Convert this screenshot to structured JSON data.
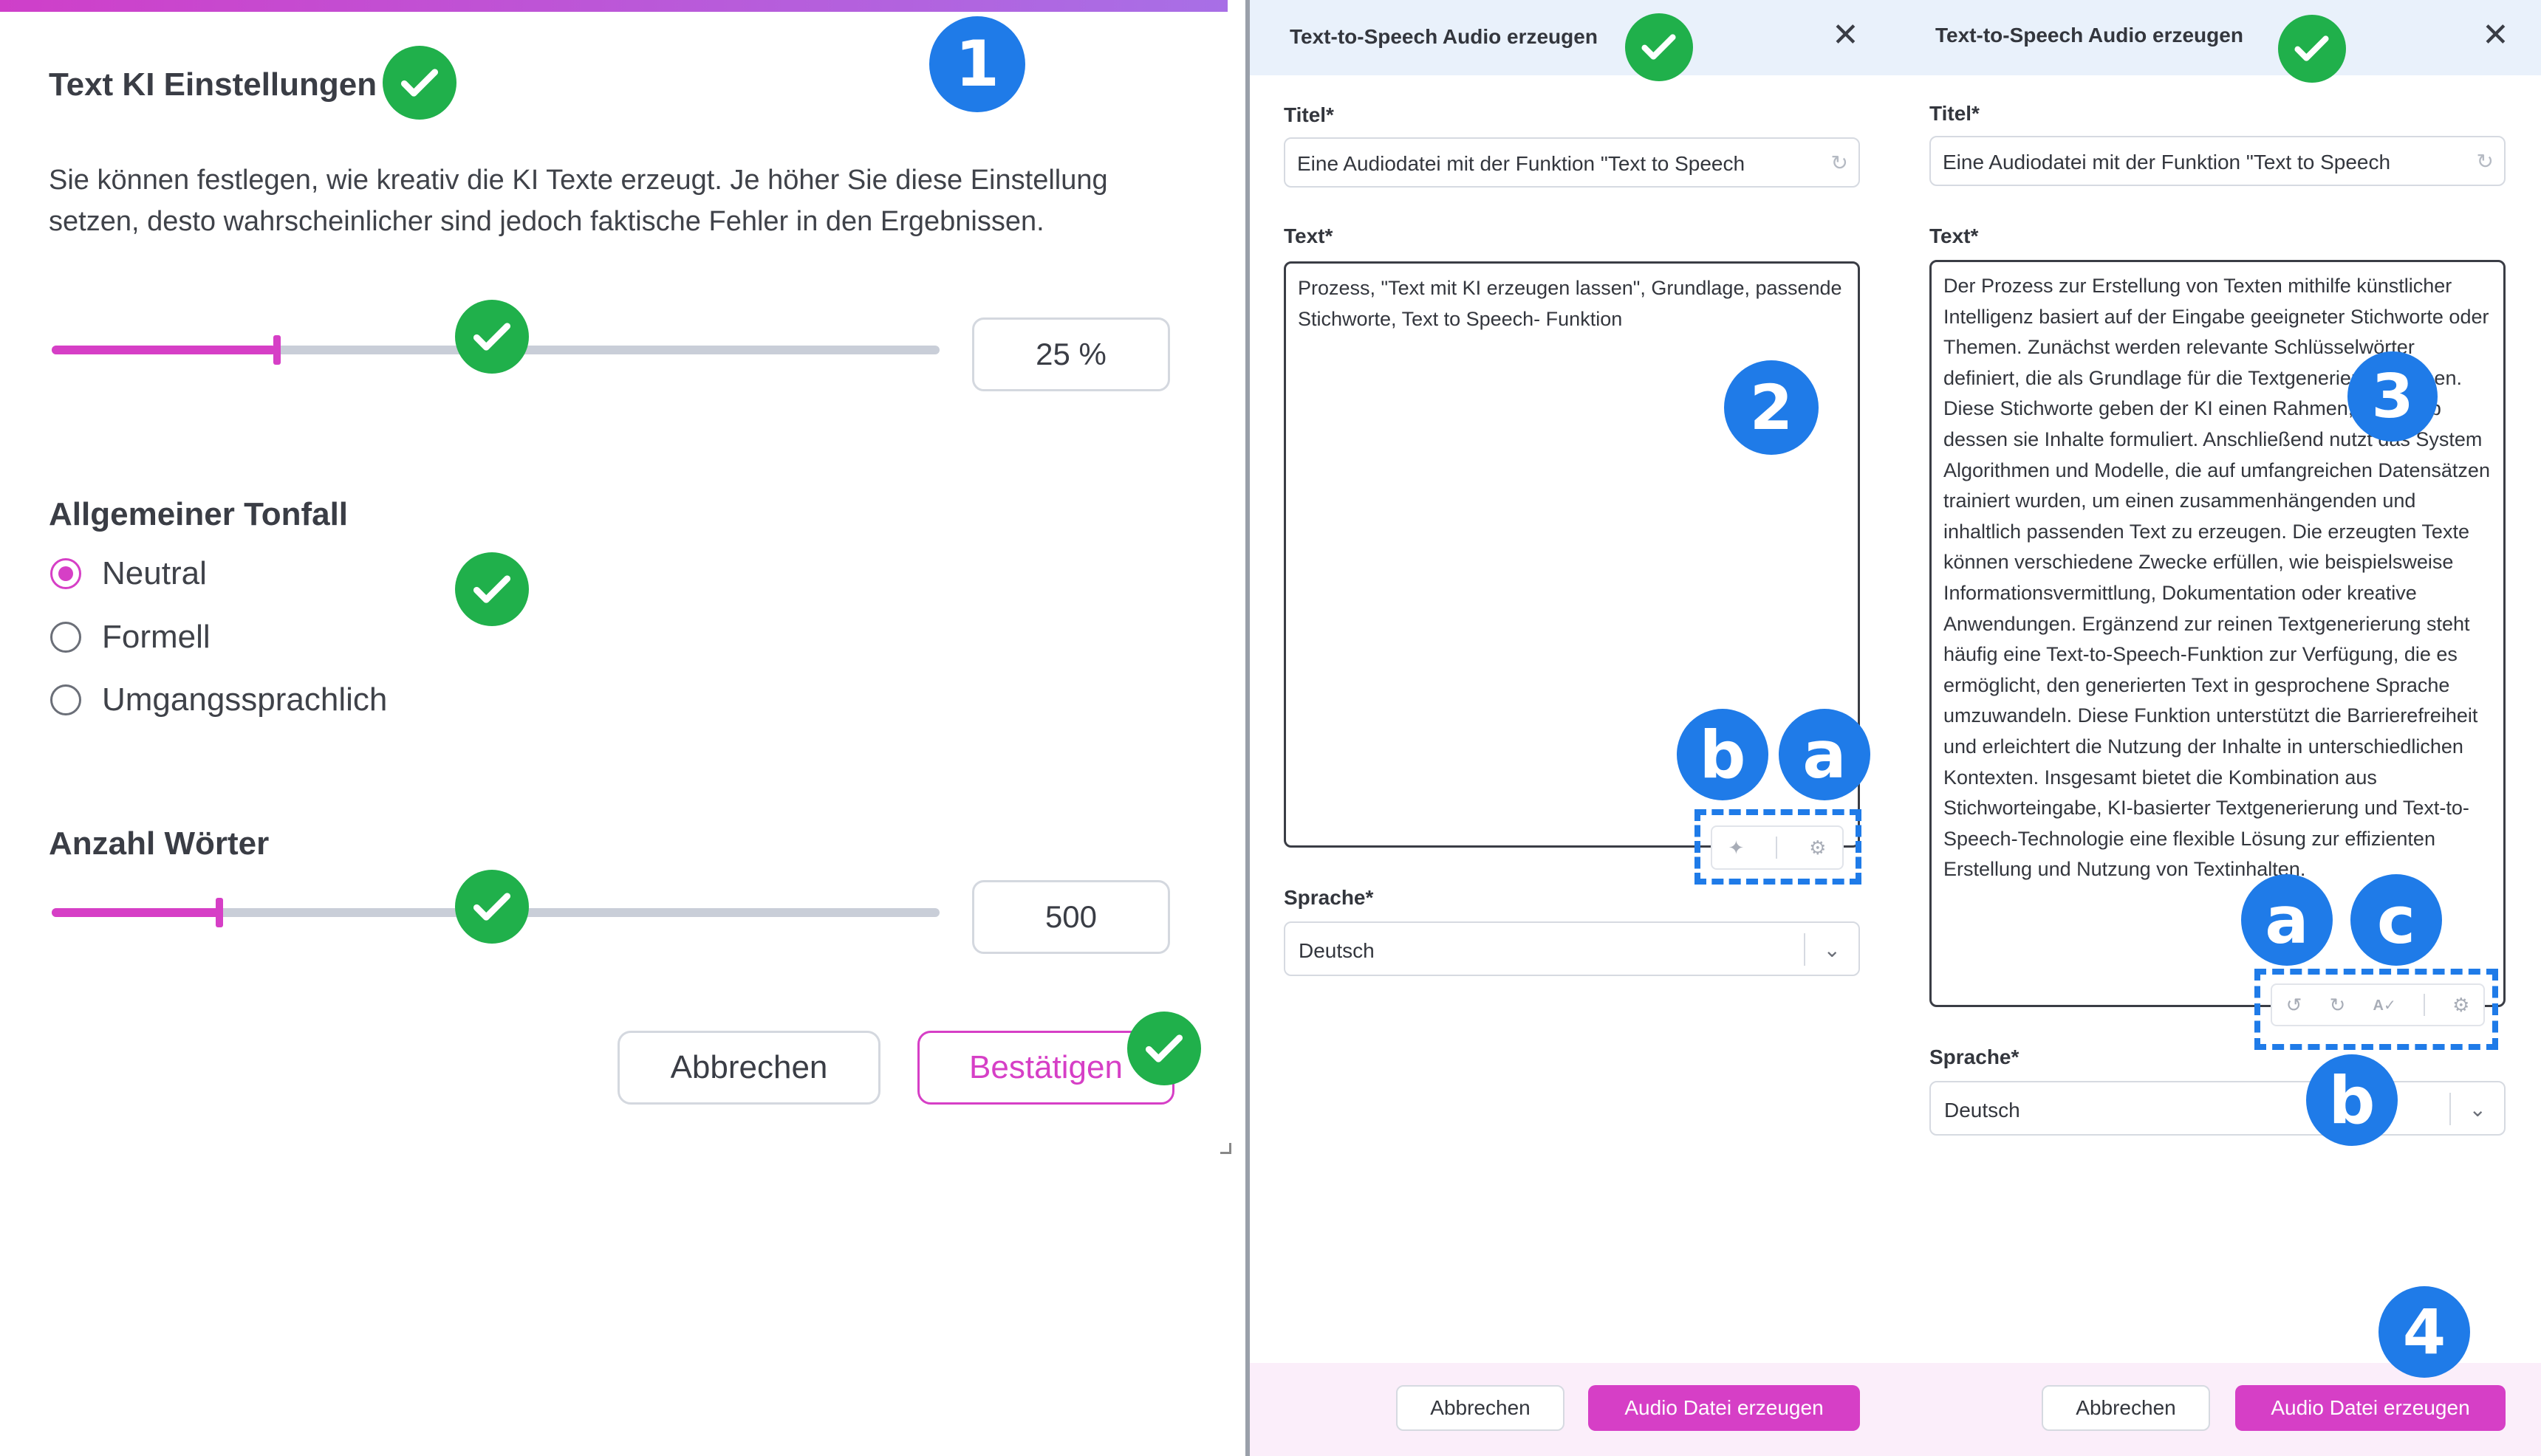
{
  "settings_panel": {
    "title": "Text KI Einstellungen",
    "description": "Sie können festlegen, wie kreativ die KI Texte erzeugt. Je höher Sie diese Einstellung setzen, desto wahrscheinlicher sind jedoch faktische Fehler in den Ergebnissen.",
    "creativity": {
      "value_text": "25 %",
      "fraction": 0.25
    },
    "tone": {
      "title": "Allgemeiner Tonfall",
      "options": [
        "Neutral",
        "Formell",
        "Umgangssprachlich"
      ],
      "selected": "Neutral"
    },
    "word_count": {
      "title": "Anzahl Wörter",
      "value_text": "500",
      "fraction": 0.19
    },
    "cancel_label": "Abbrechen",
    "confirm_label": "Bestätigen"
  },
  "dialog_a": {
    "title": "Text-to-Speech Audio erzeugen",
    "title_label": "Titel*",
    "title_value": "Eine Audiodatei mit der Funktion \"Text to Speech",
    "text_label": "Text*",
    "text_value": "Prozess, \"Text mit KI erzeugen lassen\", Grundlage, passende Stichworte, Text to Speech- Funktion",
    "language_label": "Sprache*",
    "language_value": "Deutsch",
    "cancel_label": "Abbrechen",
    "submit_label": "Audio Datei erzeugen"
  },
  "dialog_b": {
    "title": "Text-to-Speech Audio erzeugen",
    "title_label": "Titel*",
    "title_value": "Eine Audiodatei mit der Funktion \"Text to Speech",
    "text_label": "Text*",
    "text_value": "Der Prozess zur Erstellung von Texten mithilfe künstlicher Intelligenz basiert auf der Eingabe geeigneter Stichworte oder Themen. Zunächst werden relevante Schlüsselwörter definiert, die als Grundlage für die Textgenerierung dienen. Diese Stichworte geben der KI einen Rahmen, innerhalb dessen sie Inhalte formuliert. Anschließend nutzt das System Algorithmen und Modelle, die auf umfangreichen Datensätzen trainiert wurden, um einen zusammenhängenden und inhaltlich passenden Text zu erzeugen. Die erzeugten Texte können verschiedene Zwecke erfüllen, wie beispielsweise Informationsvermittlung, Dokumentation oder kreative Anwendungen. Ergänzend zur reinen Textgenerierung steht häufig eine Text-to-Speech-Funktion zur Verfügung, die es ermöglicht, den generierten Text in gesprochene Sprache umzuwandeln. Diese Funktion unterstützt die Barrierefreiheit und erleichtert die Nutzung der Inhalte in unterschiedlichen Kontexten. Insgesamt bietet die Kombination aus Stichworteingabe, KI-basierter Textgenerierung und Text-to-Speech-Technologie eine flexible Lösung zur effizienten Erstellung und Nutzung von Textinhalten.",
    "language_label": "Sprache*",
    "language_value": "Deutsch",
    "cancel_label": "Abbrechen",
    "submit_label": "Audio Datei erzeugen"
  },
  "annotations": {
    "step1": "1",
    "step2": "2",
    "step3": "3",
    "step4": "4",
    "a": "a",
    "b": "b",
    "c": "c"
  },
  "icons": {
    "close": "close-icon",
    "refresh": "refresh-icon",
    "sparkle": "sparkle-icon",
    "gear": "gear-icon",
    "undo": "undo-icon",
    "spellcheck": "spellcheck-icon",
    "chevron": "chevron-down-icon",
    "check": "check-icon"
  },
  "colors": {
    "accent": "#d63fc6",
    "marker_blue": "#1f7be8",
    "check_green": "#20b04b",
    "dialog_header": "#e9f1fb",
    "footer_tint": "#fbeefa"
  }
}
